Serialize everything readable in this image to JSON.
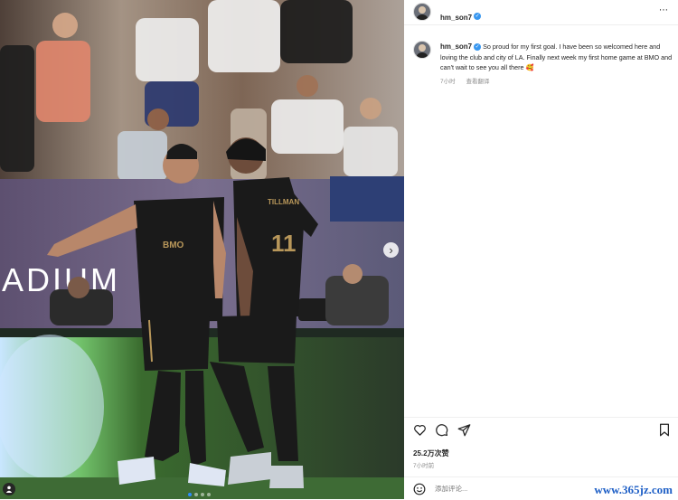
{
  "post": {
    "username": "hm_son7",
    "caption_username": "hm_son7",
    "caption": "So proud for my first goal. I have been so welcomed here and loving the club and city of LA. Finally next week my first home game at BMO and can't wait to see you all there 🥰",
    "caption_time": "7小时",
    "see_translation": "查看翻译",
    "more_icon": "⋯",
    "likes": "25.2万次赞",
    "time": "7小时前",
    "comment_placeholder": "添加评论...",
    "verified_icon": "✓"
  },
  "media": {
    "stadium_text": "ADIUM",
    "sponsor_left": "BMO",
    "player_right_name": "TILLMAN",
    "player_right_number": "11",
    "next_icon": "›",
    "slide_count": 4,
    "active_slide": 0
  },
  "watermark": "www.365jz.com",
  "colors": {
    "accent": "#3897f0",
    "kit": "#1a1a1a",
    "gold": "#b8975a",
    "pitch": "#3e6b35"
  }
}
